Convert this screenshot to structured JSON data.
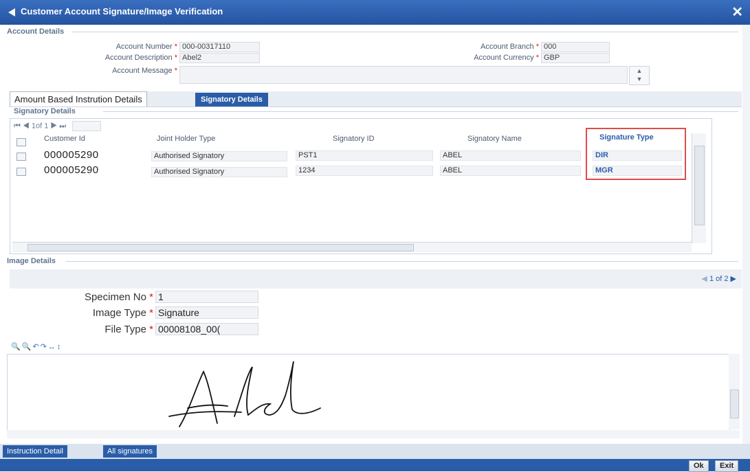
{
  "window": {
    "title": "Customer Account Signature/Image Verification",
    "close_glyph": "✕"
  },
  "account_details": {
    "section_title": "Account Details",
    "account_number_label": "Account Number",
    "account_number_value": "000-00317110",
    "account_description_label": "Account Description",
    "account_description_value": "Abel2",
    "account_message_label": "Account Message",
    "account_message_value": "",
    "account_branch_label": "Account Branch",
    "account_branch_value": "000",
    "account_currency_label": "Account Currency",
    "account_currency_value": "GBP",
    "required_mark": "*"
  },
  "tabs": {
    "amount_based": "Amount Based Instrution Details",
    "signatory_details": "Signatory Details"
  },
  "signatory": {
    "section_title": "Signatory Details",
    "pager": "1of 1",
    "columns": [
      "Customer Id",
      "Joint Holder Type",
      "Signatory ID",
      "Signatory Name",
      "Signature Type"
    ],
    "rows": [
      {
        "customer_id": "000005290",
        "joint_holder_type": "Authorised Signatory",
        "signatory_id": "PST1",
        "signatory_name": "ABEL",
        "signature_type": "DIR"
      },
      {
        "customer_id": "000005290",
        "joint_holder_type": "Authorised Signatory",
        "signatory_id": "1234",
        "signatory_name": "ABEL",
        "signature_type": "MGR"
      }
    ]
  },
  "image_details": {
    "section_title": "Image Details",
    "pager": "1 of 2",
    "specimen_no_label": "Specimen No",
    "specimen_no_value": "1",
    "image_type_label": "Image Type",
    "image_type_value": "Signature",
    "file_type_label": "File Type",
    "file_type_value": "00008108_00("
  },
  "bottom_tabs": {
    "instruction_detail": "Instruction Detail",
    "all_signatures": "All signatures"
  },
  "footer": {
    "ok": "Ok",
    "exit": "Exit"
  },
  "colors": {
    "title_bar": "#2453a0",
    "highlight_box": "#e24a4a",
    "required": "#e01515"
  }
}
